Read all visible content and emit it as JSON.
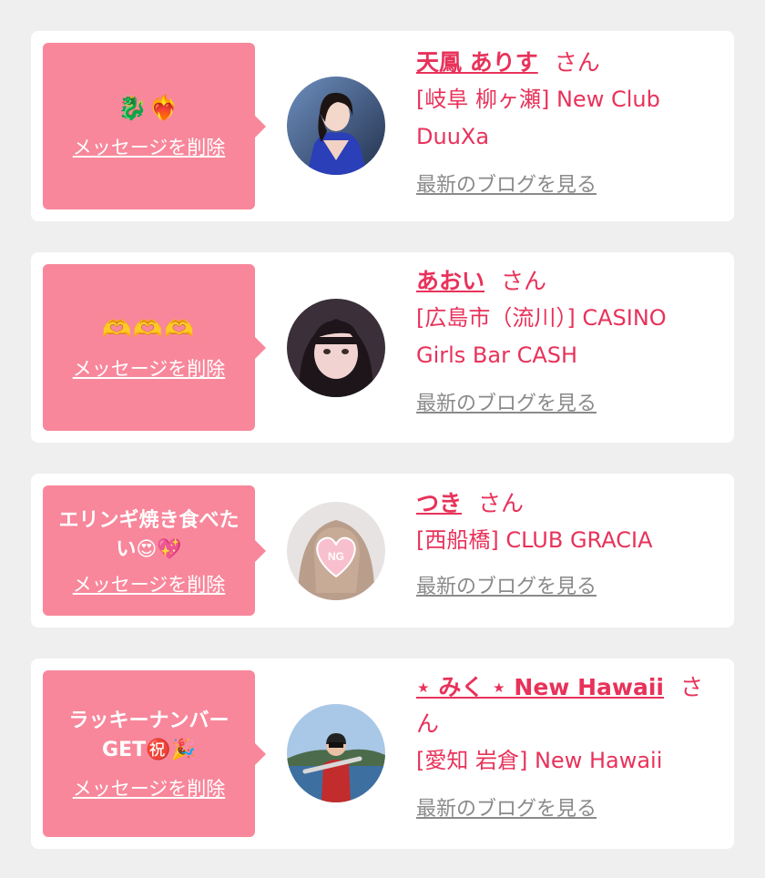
{
  "entries": [
    {
      "message": "🐉❤️‍🔥",
      "delete_label": "メッセージを削除",
      "name": "天鳳 ありす",
      "honorific": "さん",
      "store": "[岐阜 柳ヶ瀬] New Club DuuXa",
      "blog_label": "最新のブログを見る"
    },
    {
      "message": "🫶🫶🫶",
      "delete_label": "メッセージを削除",
      "name": "あおい",
      "honorific": "さん",
      "store": "[広島市（流川）] CASINO Girls Bar CASH",
      "blog_label": "最新のブログを見る"
    },
    {
      "message": "エリンギ焼き食べたい😍💖",
      "delete_label": "メッセージを削除",
      "name": "つき",
      "honorific": "さん",
      "store": "[西船橋] CLUB GRACIA",
      "blog_label": "最新のブログを見る",
      "avatar_badge": "NG"
    },
    {
      "message": "ラッキーナンバーGET㊗️🎉",
      "delete_label": "メッセージを削除",
      "name": "⋆ みく ⋆ New Hawaii",
      "honorific": "さん",
      "store": "[愛知 岩倉] New Hawaii",
      "blog_label": "最新のブログを見る"
    }
  ]
}
